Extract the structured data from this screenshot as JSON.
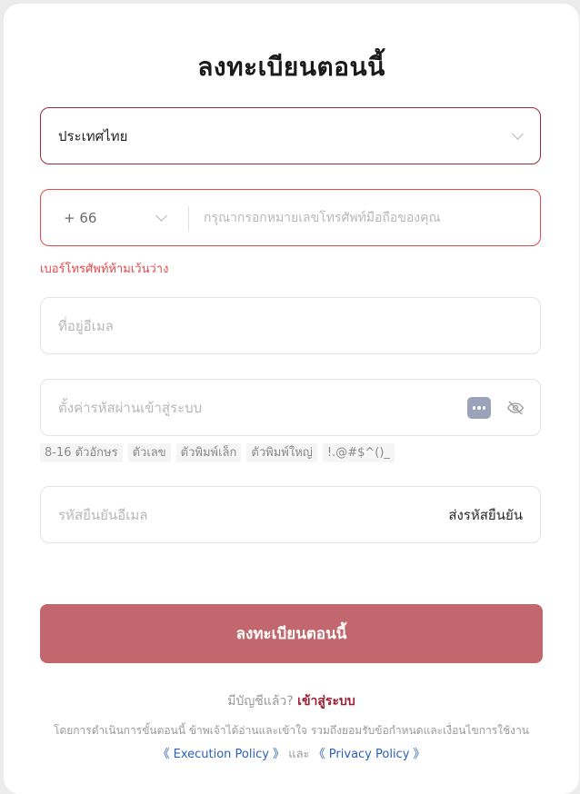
{
  "title": "ลงทะเบียนตอนนี้",
  "country": {
    "value": "ประเทศไทย"
  },
  "phone": {
    "code": "+ 66",
    "placeholder": "กรุณากรอกหมายเลขโทรศัพท์มือถือของคุณ",
    "error": "เบอร์โทรศัพท์ห้ามเว้นว่าง"
  },
  "email": {
    "placeholder": "ที่อยู่อีเมล"
  },
  "password": {
    "placeholder": "ตั้งค่ารหัสผ่านเข้าสู่ระบบ",
    "hints": [
      "8-16 ตัวอักษร",
      "ตัวเลข",
      "ตัวพิมพ์เล็ก",
      "ตัวพิมพ์ใหญ่",
      "!.@#$^()_"
    ]
  },
  "code": {
    "placeholder": "รหัสยืนยันอีเมล",
    "send_label": "ส่งรหัสยืนยัน"
  },
  "submit_label": "ลงทะเบียนตอนนี้",
  "login": {
    "prompt": "มีบัญชีแล้ว?",
    "link": "เข้าสู่ระบบ"
  },
  "terms": {
    "text": "โดยการดำเนินการขั้นตอนนี้ ข้าพเจ้าได้อ่านและเข้าใจ รวมถึงยอมรับข้อกำหนดและเงื่อนไขการใช้งาน",
    "execution_policy": "《 Execution Policy 》",
    "and": "และ",
    "privacy_policy": "《 Privacy Policy 》"
  },
  "colors": {
    "accent": "#9c1f33",
    "button": "#c2676d",
    "error": "#e5484d",
    "link": "#2b5fb8"
  }
}
